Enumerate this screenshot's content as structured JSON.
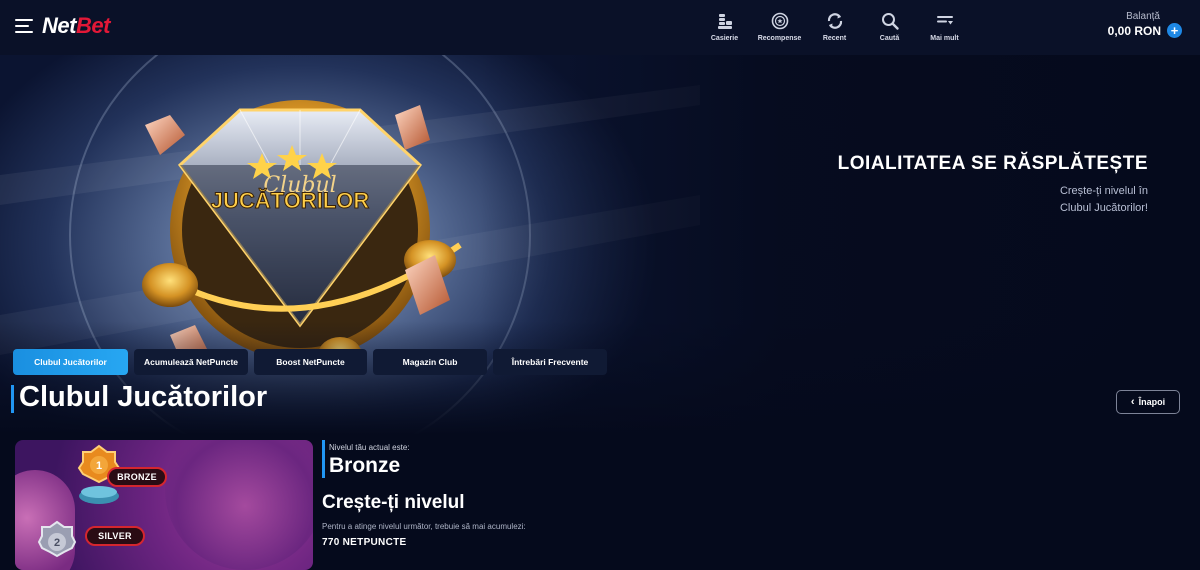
{
  "header": {
    "logo_net": "Net",
    "logo_bet": "Bet",
    "nav": [
      {
        "label": "Casierie",
        "icon": "cashier-icon"
      },
      {
        "label": "Recompense",
        "icon": "rewards-icon"
      },
      {
        "label": "Recent",
        "icon": "recent-icon"
      },
      {
        "label": "Caută",
        "icon": "search-icon"
      },
      {
        "label": "Mai mult",
        "icon": "more-icon"
      }
    ],
    "balance_label": "Balanță",
    "balance_value": "0,00 RON",
    "deposit_symbol": "+"
  },
  "hero": {
    "title": "LOIALITATEA SE RĂSPLĂTEȘTE",
    "subtitle": "Crește-ți nivelul în Clubul Jucătorilor!",
    "badge_script": "Clubul",
    "badge_title": "JUCĂTORILOR"
  },
  "tabs": [
    {
      "label": "Clubul Jucătorilor",
      "active": true
    },
    {
      "label": "Acumulează NetPuncte",
      "active": false
    },
    {
      "label": "Boost NetPuncte",
      "active": false
    },
    {
      "label": "Magazin Club",
      "active": false
    },
    {
      "label": "Întrebări Frecvente",
      "active": false
    }
  ],
  "page": {
    "title": "Clubul Jucătorilor",
    "back_label": "Înapoi"
  },
  "levels": {
    "level1_number": "1",
    "level1_name": "BRONZE",
    "level2_number": "2",
    "level2_name": "SILVER"
  },
  "status": {
    "current_caption": "Nivelul tău actual este:",
    "current_level": "Bronze",
    "grow_title": "Crește-ți nivelul",
    "grow_desc": "Pentru a atinge nivelul următor, trebuie să mai acumulezi:",
    "points_needed": "770 NETPUNCTE"
  },
  "colors": {
    "accent_blue": "#2196f3",
    "brand_red": "#e31837",
    "background": "#050a1c"
  }
}
